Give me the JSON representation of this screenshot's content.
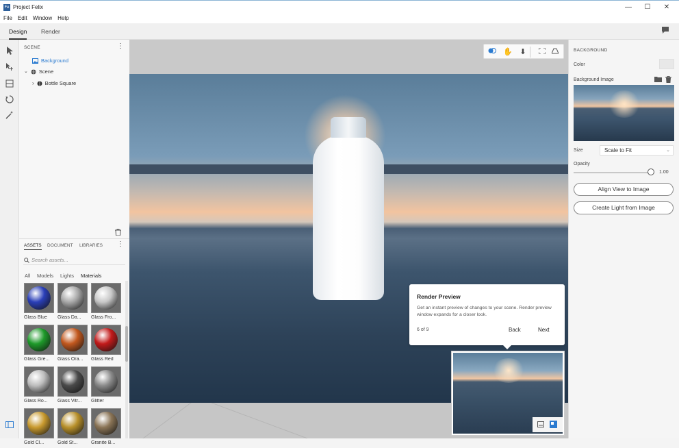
{
  "app": {
    "icon_text": "Fe",
    "title": "Project Felix"
  },
  "window_controls": {
    "minimize": "—",
    "maximize": "☐",
    "close": "✕"
  },
  "menu": [
    "File",
    "Edit",
    "Window",
    "Help"
  ],
  "modes": {
    "design": "Design",
    "render": "Render",
    "active": "Design"
  },
  "scene_panel": {
    "header": "SCENE",
    "items": [
      {
        "label": "Background",
        "selected": true
      },
      {
        "label": "Scene"
      },
      {
        "label": "Bottle Square"
      }
    ]
  },
  "assets_panel": {
    "tabs": [
      "ASSETS",
      "DOCUMENT",
      "LIBRARIES"
    ],
    "search_placeholder": "Search assets...",
    "filters": [
      "All",
      "Models",
      "Lights",
      "Materials"
    ],
    "materials": [
      {
        "label": "Glass Blue",
        "color": "#2a3fb8"
      },
      {
        "label": "Glass Da...",
        "color": "#a9a9a9"
      },
      {
        "label": "Glass Fro...",
        "color": "#c8c8c8"
      },
      {
        "label": "Glass Gre...",
        "color": "#1e9a2a"
      },
      {
        "label": "Glass Ora...",
        "color": "#c2581e"
      },
      {
        "label": "Glass Red",
        "color": "#c21a1a"
      },
      {
        "label": "Glass Ro...",
        "color": "#bdbdbd"
      },
      {
        "label": "Glass Vitr...",
        "color": "#4a4a4a"
      },
      {
        "label": "Glitter",
        "color": "#8a8a8a"
      },
      {
        "label": "Gold Cl...",
        "color": "#c99a2e"
      },
      {
        "label": "Gold St...",
        "color": "#b8902a"
      },
      {
        "label": "Granite B...",
        "color": "#8a7456"
      }
    ]
  },
  "tooltip": {
    "title": "Render Preview",
    "body": "Get an instant preview of changes to your scene. Render preview window expands for a closer look.",
    "step": "6 of 9",
    "back": "Back",
    "next": "Next"
  },
  "properties": {
    "header": "BACKGROUND",
    "color_label": "Color",
    "bg_image_label": "Background Image",
    "size_label": "Size",
    "size_value": "Scale to Fit",
    "opacity_label": "Opacity",
    "opacity_value": "1.00",
    "align_button": "Align View to Image",
    "light_button": "Create Light from Image"
  }
}
